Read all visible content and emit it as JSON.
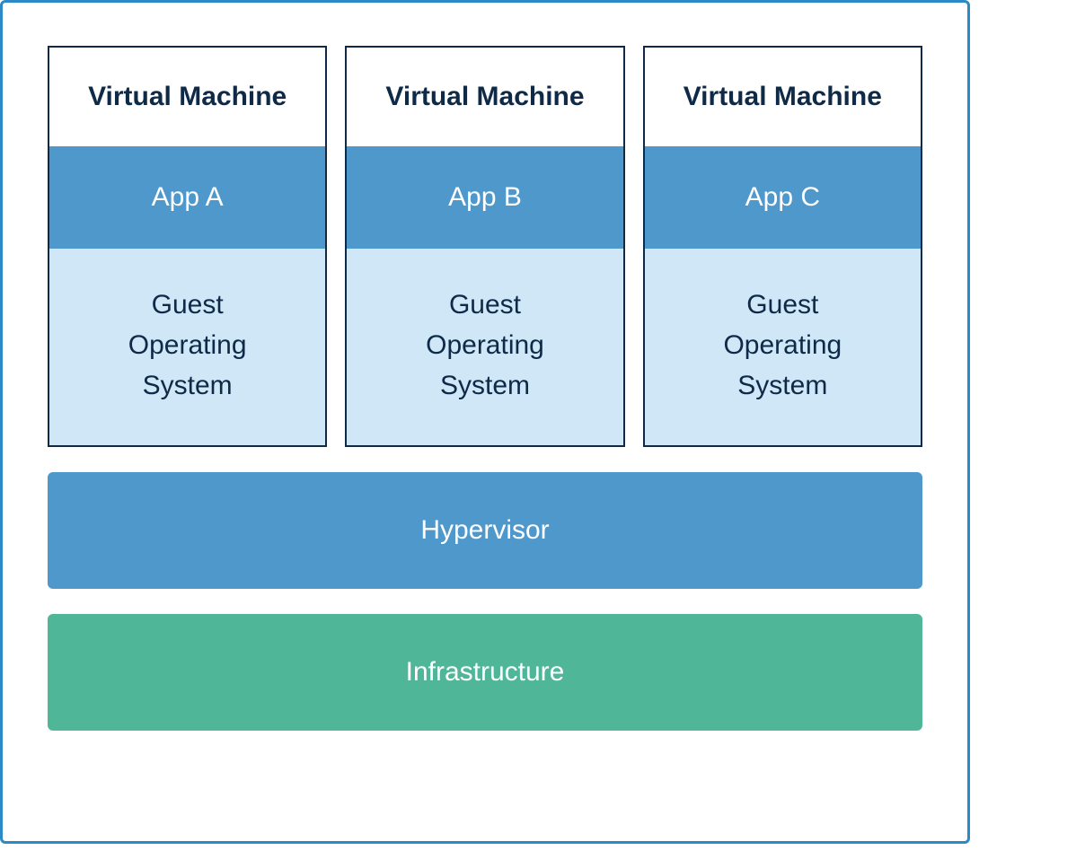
{
  "diagram": {
    "vms": [
      {
        "title": "Virtual Machine",
        "app": "App A",
        "guest_line1": "Guest",
        "guest_line2": "Operating",
        "guest_line3": "System"
      },
      {
        "title": "Virtual Machine",
        "app": "App B",
        "guest_line1": "Guest",
        "guest_line2": "Operating",
        "guest_line3": "System"
      },
      {
        "title": "Virtual Machine",
        "app": "App C",
        "guest_line1": "Guest",
        "guest_line2": "Operating",
        "guest_line3": "System"
      }
    ],
    "hypervisor": "Hypervisor",
    "infrastructure": "Infrastructure"
  },
  "colors": {
    "border": "#2b89c5",
    "dark_text": "#0e2a47",
    "blue_fill": "#4e98cc",
    "light_blue": "#cfe7f7",
    "green_fill": "#4fb797"
  }
}
